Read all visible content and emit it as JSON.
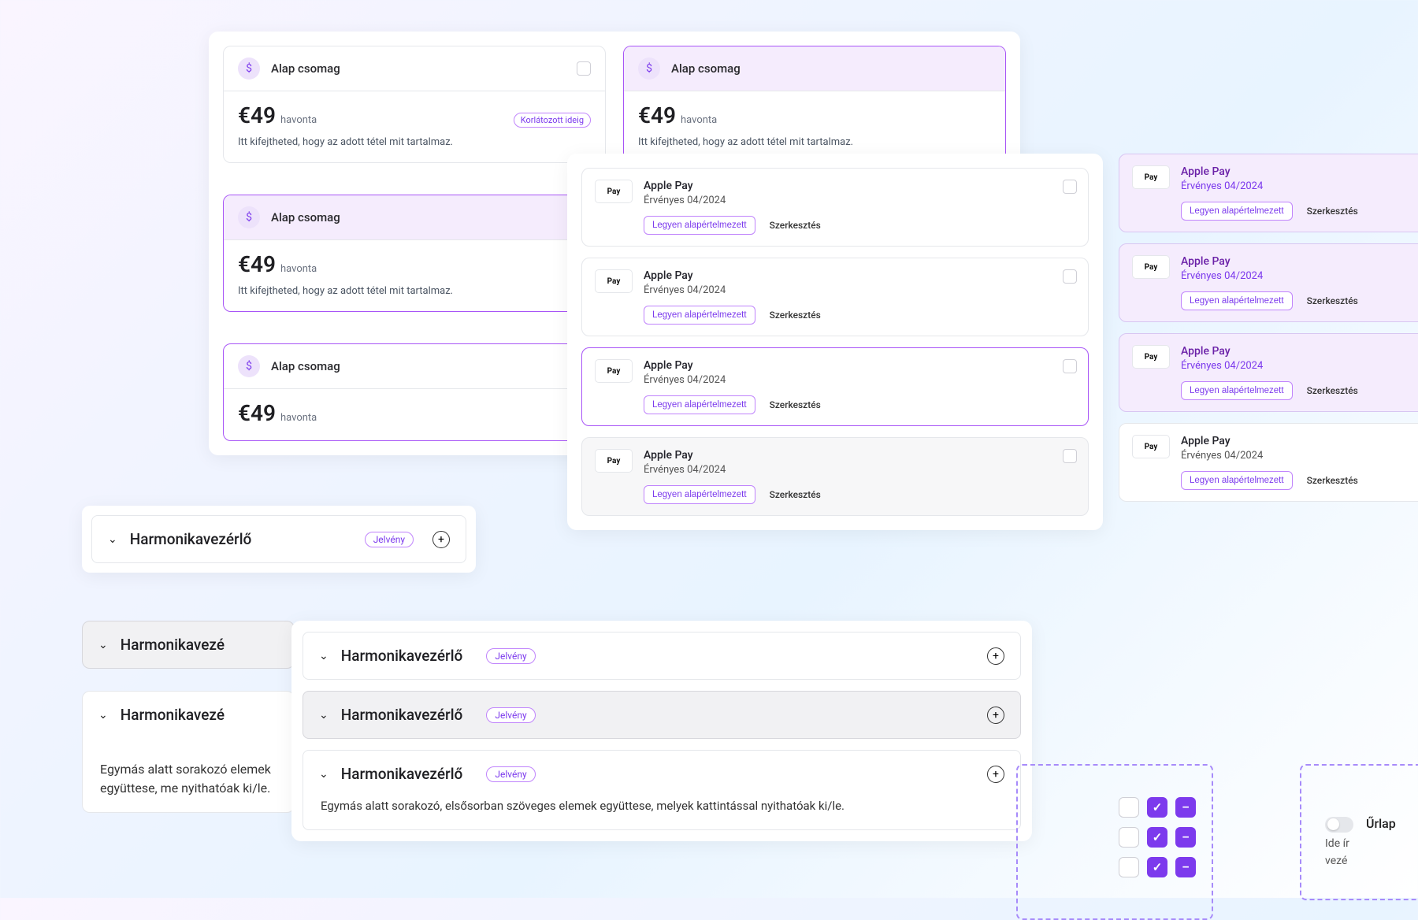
{
  "pricing": {
    "title": "Alap csomag",
    "amount": "€49",
    "period": "havonta",
    "badge": "Korlátozott ideig",
    "desc": "Itt kifejtheted, hogy az adott tétel mit tartalmaz."
  },
  "payment": {
    "name": "Apple Pay",
    "logo": "Pay",
    "sub": "Érvényes 04/2024",
    "default_btn": "Legyen alapértelmezett",
    "edit": "Szerkesztés"
  },
  "accordion": {
    "title": "Harmonikavezérlő",
    "title_trunc": "Harmonikavezé",
    "badge": "Jelvény",
    "desc_short": "Egymás alatt sorakozó elemek együttese, me nyithatóak ki/le.",
    "desc_long": "Egymás alatt sorakozó, elsősorban szöveges elemek együttese, melyek kattintással nyithatóak ki/le."
  },
  "form": {
    "label": "Űrlap",
    "sub1": "Ide ír",
    "sub2": "vezé"
  }
}
